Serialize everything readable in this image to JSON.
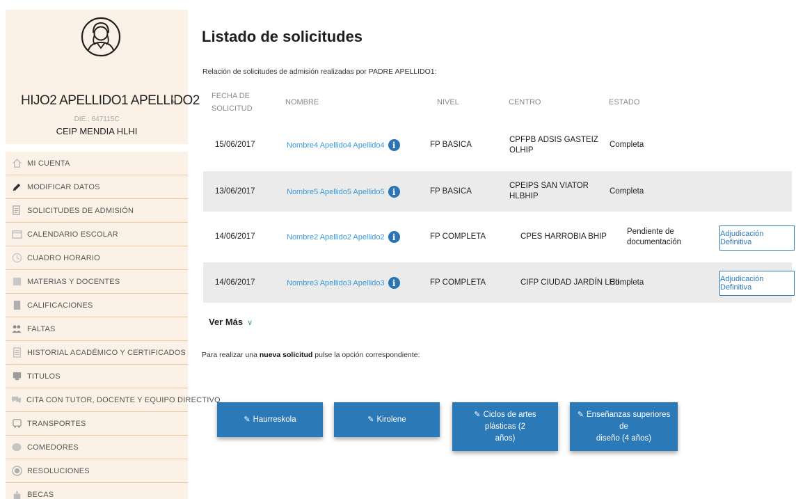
{
  "profile": {
    "child_name": "HIJO2 APELLIDO1 APELLIDO2",
    "die": "DIE.: 647115C",
    "school": "CEIP MENDIA HLHI"
  },
  "menu": [
    {
      "label": "MI CUENTA",
      "icon": "home-icon"
    },
    {
      "label": "MODIFICAR DATOS",
      "icon": "pencil-icon"
    },
    {
      "label": "SOLICITUDES DE ADMISIÓN",
      "icon": "document-icon"
    },
    {
      "label": "CALENDARIO ESCOLAR",
      "icon": "calendar-icon"
    },
    {
      "label": "CUADRO HORARIO",
      "icon": "clock-icon"
    },
    {
      "label": "MATERIAS Y DOCENTES",
      "icon": "book-icon"
    },
    {
      "label": "CALIFICACIONES",
      "icon": "grades-icon"
    },
    {
      "label": "FALTAS",
      "icon": "people-icon"
    },
    {
      "label": "HISTORIAL ACADÉMICO Y CERTIFICADOS",
      "icon": "certificate-icon"
    },
    {
      "label": "TITULOS",
      "icon": "graduation-icon"
    },
    {
      "label": "CITA CON TUTOR, DOCENTE Y EQUIPO DIRECTIVO",
      "icon": "chat-icon"
    },
    {
      "label": "TRANSPORTES",
      "icon": "bus-icon"
    },
    {
      "label": "COMEDORES",
      "icon": "dining-icon"
    },
    {
      "label": "RESOLUCIONES",
      "icon": "check-icon"
    },
    {
      "label": "BECAS",
      "icon": "scholarship-icon"
    }
  ],
  "main": {
    "title": "Listado de solicitudes",
    "relation": "Relación de solicitudes de admisión realizadas por PADRE APELLIDO1:",
    "columns": {
      "fecha_line1": "FECHA DE",
      "fecha_line2": "SOLICITUD",
      "nombre": "NOMBRE",
      "nivel": "NIVEL",
      "centro": "CENTRO",
      "estado": "ESTADO"
    },
    "rows": [
      {
        "fecha": "15/06/2017",
        "nombre": "Nombre4 Apellido4 Apellido4",
        "nivel": "FP BASICA",
        "centro1": "CPFPB ADSIS GASTEIZ",
        "centro2": "OLHIP",
        "estado1": "Completa",
        "estado2": "",
        "accion": ""
      },
      {
        "fecha": "13/06/2017",
        "nombre": "Nombre5 Apellido5 Apellido5",
        "nivel": "FP BASICA",
        "centro1": "CPEIPS SAN VIATOR",
        "centro2": "HLBHIP",
        "estado1": "Completa",
        "estado2": "",
        "accion": ""
      },
      {
        "fecha": "14/06/2017",
        "nombre": "Nombre2 Apellido2 Apellido2",
        "nivel": "FP COMPLETA",
        "centro1": "CPES HARROBIA BHIP",
        "centro2": "",
        "estado1": "Pendiente de",
        "estado2": "documentación",
        "accion": "Adjudicación Definitiva"
      },
      {
        "fecha": "14/06/2017",
        "nombre": "Nombre3 Apellido3 Apellido3",
        "nivel": "FP COMPLETA",
        "centro1": "CIFP CIUDAD JARDÍN LHII",
        "centro2": "",
        "estado1": "Completa",
        "estado2": "",
        "accion": "Adjudicación Definitiva"
      }
    ],
    "ver_mas": "Ver Más",
    "new_req_prefix": "Para realizar una ",
    "new_req_bold": "nueva solicitud",
    "new_req_suffix": " pulse la opción correspondiente:",
    "buttons": [
      {
        "label1": "Haurreskola",
        "label2": ""
      },
      {
        "label1": "Kirolene",
        "label2": ""
      },
      {
        "label1": "Ciclos de artes plásticas (2",
        "label2": "años)"
      },
      {
        "label1": "Enseñanzas superiores de",
        "label2": "diseño (4 años)"
      }
    ]
  },
  "colors": {
    "sidebar_bg": "#fbf1e6",
    "menu_divider": "#edc89e",
    "link": "#3a9ad9",
    "primary": "#2c79b8",
    "row_alt": "#ebebeb"
  }
}
